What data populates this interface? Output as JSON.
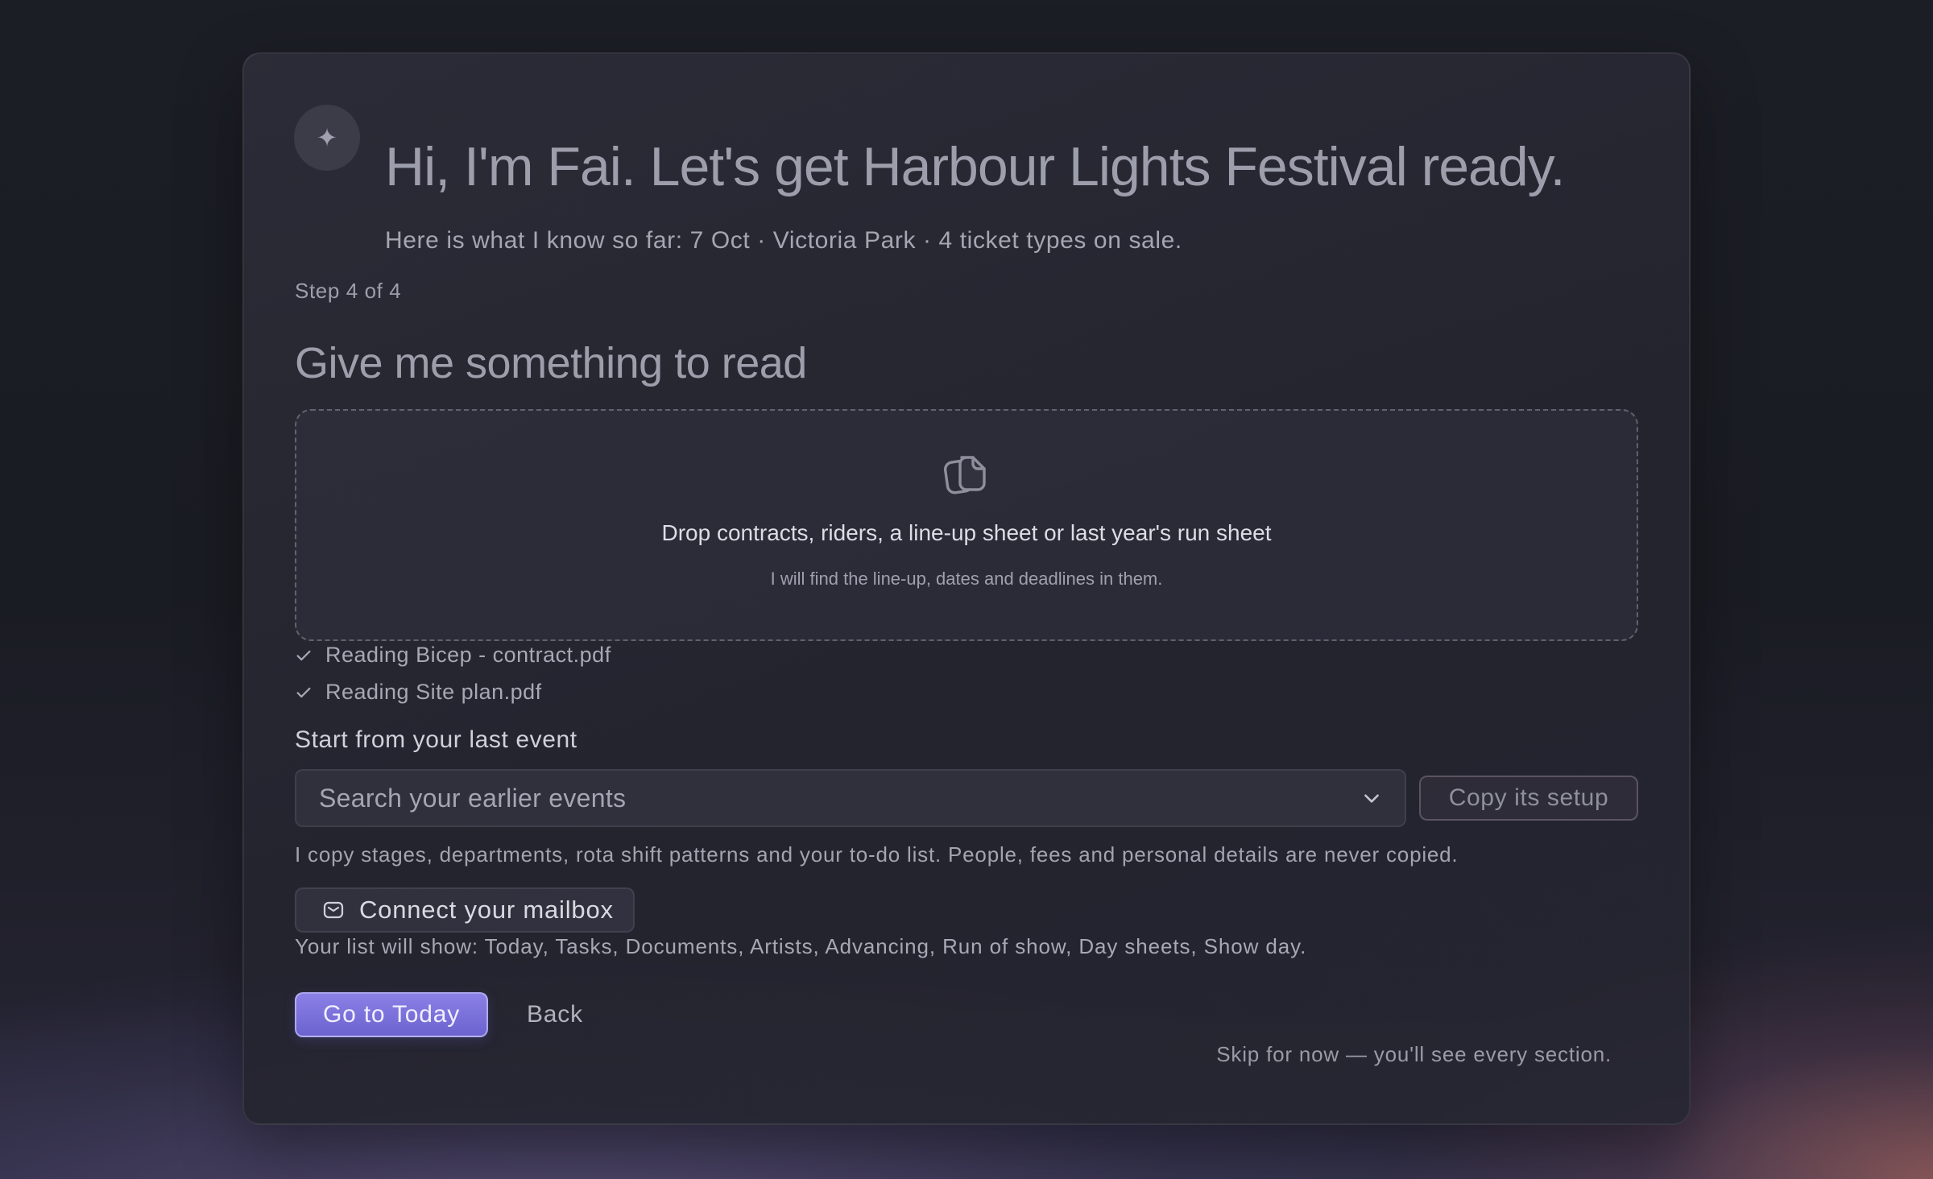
{
  "assistant": {
    "icon": "sparkle-icon",
    "glyph": "✦"
  },
  "hero": {
    "title": "Hi, I'm Fai. Let's get Harbour Lights Festival ready.",
    "subtitle": "Here is what I know so far: 7 Oct · Victoria Park · 4 ticket types on sale."
  },
  "step": {
    "label": "Step 4 of 4"
  },
  "section": {
    "title": "Give me something to read"
  },
  "dropzone": {
    "icon": "documents-icon",
    "title": "Drop contracts, riders, a line-up sheet or last year's run sheet",
    "subtitle": "I will find the line-up, dates and deadlines in them."
  },
  "files": [
    {
      "label": "Reading Bicep - contract.pdf",
      "icon": "check-icon"
    },
    {
      "label": "Reading Site plan.pdf",
      "icon": "check-icon"
    }
  ],
  "last_event": {
    "label": "Start from your last event",
    "search_placeholder": "Search your earlier events",
    "copy_button": "Copy its setup",
    "note": "I copy stages, departments, rota shift patterns and your to-do list. People, fees and personal details are never copied."
  },
  "mailbox": {
    "button": "Connect your mailbox",
    "icon": "mail-icon"
  },
  "list_note": "Your list will show: Today, Tasks, Documents, Artists, Advancing, Run of show, Day sheets, Show day.",
  "actions": {
    "primary": "Go to Today",
    "back": "Back",
    "skip": "Skip for now — you'll see every section."
  },
  "colors": {
    "accent": "#7a70db",
    "card": "#2a2b36",
    "background": "#1c1e26"
  }
}
